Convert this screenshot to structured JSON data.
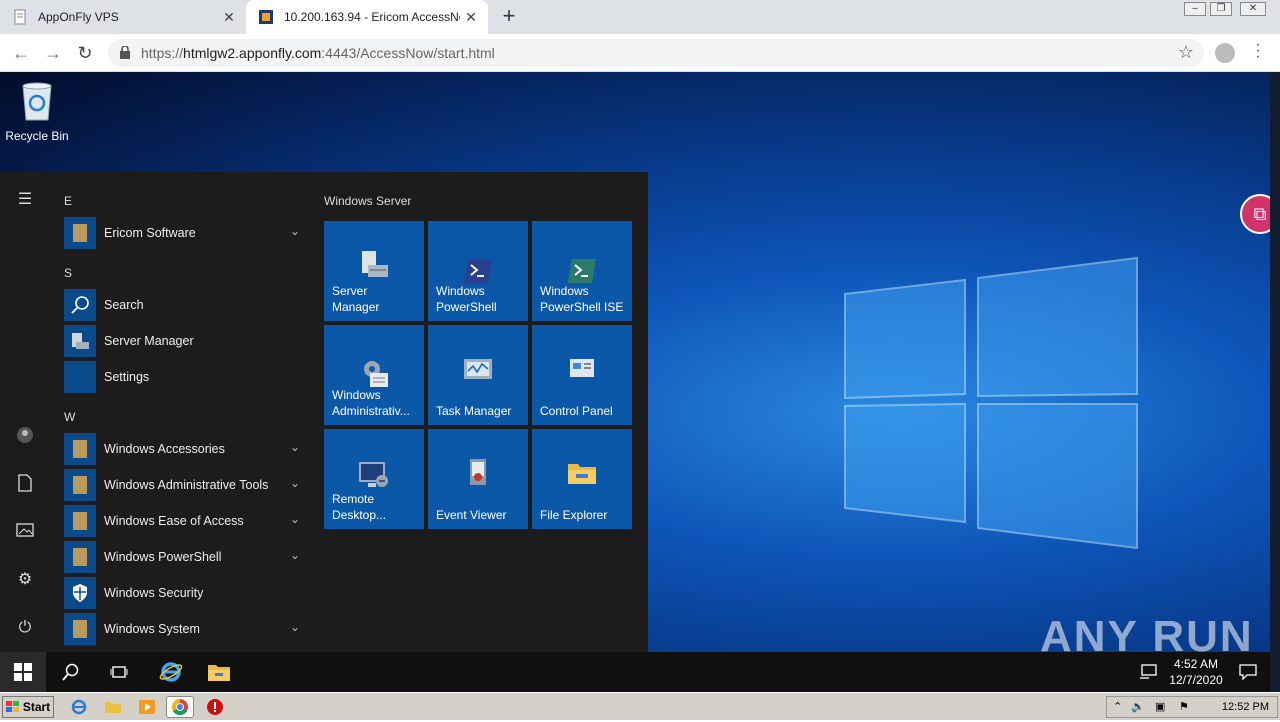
{
  "browser": {
    "tabs": [
      {
        "title": "AppOnFly VPS",
        "active": false
      },
      {
        "title": "10.200.163.94 - Ericom AccessNow (",
        "active": true
      }
    ],
    "url_scheme": "https://",
    "url_host": "htmlgw2.apponfly.com",
    "url_rest": ":4443/AccessNow/start.html"
  },
  "desktop": {
    "recycle_bin": "Recycle Bin",
    "watermark": "ANY RUN"
  },
  "start_menu": {
    "groups": [
      {
        "letter": "E",
        "apps": [
          {
            "label": "Ericom Software",
            "expandable": true
          }
        ]
      },
      {
        "letter": "S",
        "apps": [
          {
            "label": "Search",
            "expandable": false
          },
          {
            "label": "Server Manager",
            "expandable": false
          },
          {
            "label": "Settings",
            "expandable": false
          }
        ]
      },
      {
        "letter": "W",
        "apps": [
          {
            "label": "Windows Accessories",
            "expandable": true
          },
          {
            "label": "Windows Administrative Tools",
            "expandable": true
          },
          {
            "label": "Windows Ease of Access",
            "expandable": true
          },
          {
            "label": "Windows PowerShell",
            "expandable": true
          },
          {
            "label": "Windows Security",
            "expandable": false
          },
          {
            "label": "Windows System",
            "expandable": true
          }
        ]
      }
    ],
    "tiles_title": "Windows Server",
    "tiles": [
      {
        "label": "Server Manager"
      },
      {
        "label": "Windows PowerShell"
      },
      {
        "label": "Windows PowerShell ISE"
      },
      {
        "label": "Windows Administrativ..."
      },
      {
        "label": "Task Manager"
      },
      {
        "label": "Control Panel"
      },
      {
        "label": "Remote Desktop..."
      },
      {
        "label": "Event Viewer"
      },
      {
        "label": "File Explorer"
      }
    ]
  },
  "remote_taskbar": {
    "time": "4:52 AM",
    "date": "12/7/2020"
  },
  "host_taskbar": {
    "start_label": "Start",
    "time": "12:52 PM"
  },
  "colors": {
    "tile_blue": "#0b58a8",
    "menu_bg": "#1c1c1c",
    "helper_pink": "#d0336a"
  }
}
